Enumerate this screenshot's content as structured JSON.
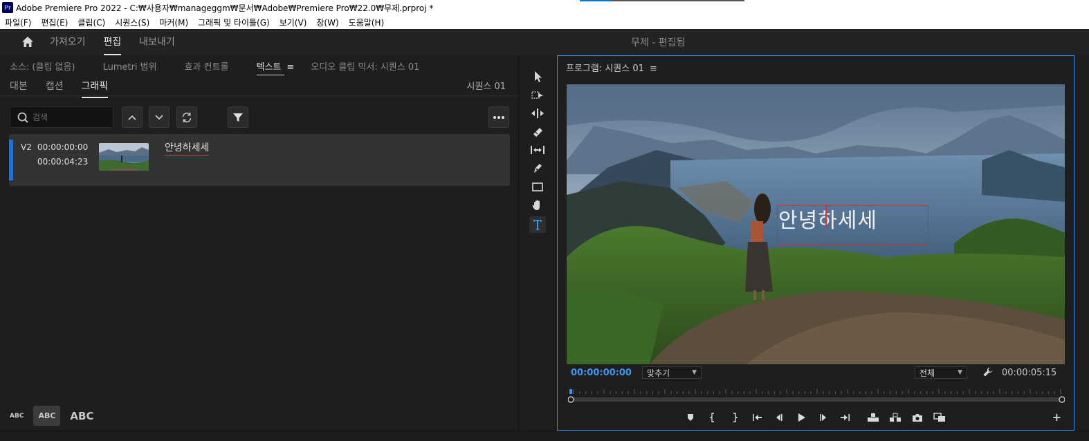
{
  "window": {
    "title": "Adobe Premiere Pro 2022 - C:₩사용자₩manageggm₩문서₩Adobe₩Premiere Pro₩22.0₩무제.prproj *",
    "app_badge": "Pr"
  },
  "menu": [
    "파일(F)",
    "편집(E)",
    "클립(C)",
    "시퀀스(S)",
    "마커(M)",
    "그래픽 및 타이틀(G)",
    "보기(V)",
    "창(W)",
    "도움말(H)"
  ],
  "workspace": {
    "tabs": [
      "가져오기",
      "편집",
      "내보내기"
    ],
    "active": "편집",
    "project_status": "무제 - 편집됨"
  },
  "left_panel": {
    "tabs": [
      "소스: (클립 없음)",
      "Lumetri 범위",
      "효과 컨트롤",
      "텍스트",
      "오디오 클립 믹서: 시퀀스 01"
    ],
    "active_tab": "텍스트",
    "menu_icon": "≡",
    "sub_tabs": [
      "대본",
      "캡션",
      "그래픽"
    ],
    "active_sub_tab": "그래픽",
    "sequence_label": "시퀀스 01",
    "search_placeholder": "검색",
    "clip": {
      "track": "V2",
      "in": "00:00:00:00",
      "out": "00:00:04:23",
      "name": "안녕하세세"
    },
    "abc_buttons": [
      "ABC",
      "ABC",
      "ABC"
    ]
  },
  "program": {
    "title": "프로그램: 시퀀스 01",
    "menu_icon": "≡",
    "overlay_text": "안녕하세세",
    "current_tc": "00:00:00:00",
    "fit": "맞추기",
    "quality": "전체",
    "duration_tc": "00:00:05:15",
    "add_button": "+"
  },
  "colors": {
    "accent_blue": "#2d8ceb",
    "timecode_blue": "#3d95f2",
    "clip_marker": "#1c72d8",
    "selection_red": "#d03030"
  }
}
